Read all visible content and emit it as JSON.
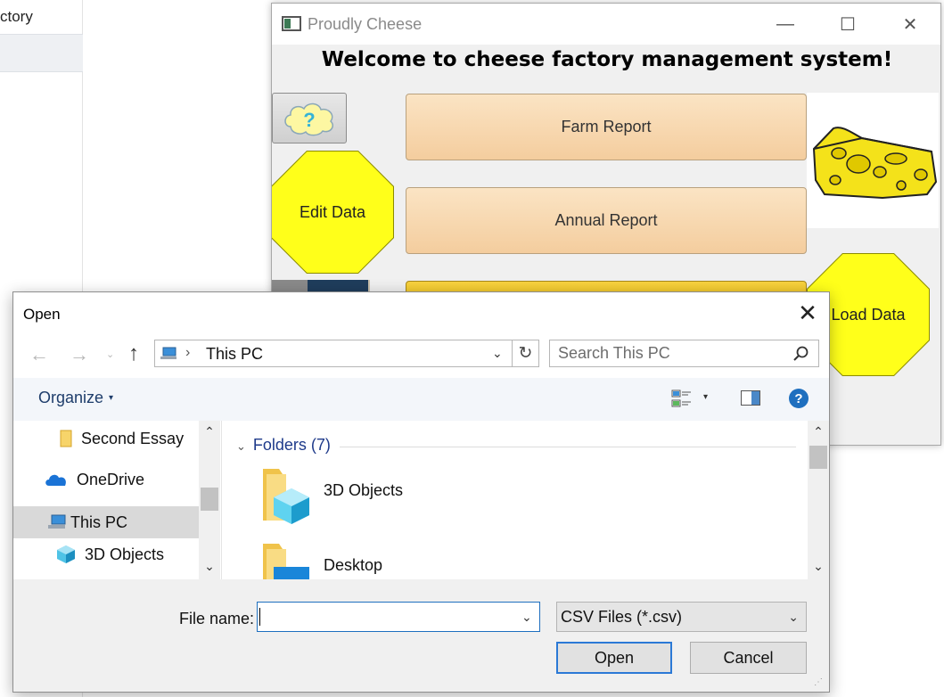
{
  "background_app": {
    "tree_item_label": "ctory"
  },
  "cheese_window": {
    "title": "Proudly Cheese",
    "controls": {
      "minimize": "—",
      "maximize": "☐",
      "close": "✕"
    },
    "heading": "Welcome to cheese factory management system!",
    "buttons": {
      "farm_report": "Farm Report",
      "annual_report": "Annual Report",
      "edit_data": "Edit Data",
      "load_data": "Load Data"
    },
    "help_button_glyph": "?",
    "icons": {
      "help": "question-cloud-icon",
      "cheese": "cheese-image"
    },
    "colors": {
      "octagon": "#ffff1a",
      "report_button": "#f7d7ab",
      "third_button": "#f0c419"
    }
  },
  "open_dialog": {
    "title": "Open",
    "close_glyph": "✕",
    "nav": {
      "back": "←",
      "forward": "→",
      "recent": "⌄",
      "up": "↑"
    },
    "address": {
      "separator": "›",
      "location": "This PC",
      "dropdown": "⌄"
    },
    "refresh_glyph": "↻",
    "search": {
      "placeholder": "Search This PC"
    },
    "toolbar": {
      "organize_label": "Organize",
      "organize_caret": "▾",
      "view_caret": "▾",
      "help_glyph": "?"
    },
    "nav_pane": {
      "items": [
        {
          "label": "Second Essay",
          "icon": "folder-icon"
        },
        {
          "label": "OneDrive",
          "icon": "cloud-icon"
        },
        {
          "label": "This PC",
          "icon": "computer-icon",
          "selected": true
        },
        {
          "label": "3D Objects",
          "icon": "cube-icon"
        }
      ],
      "scroll_up": "⌃",
      "scroll_down": "⌄"
    },
    "file_list": {
      "group_header": "Folders (7)",
      "group_chevron": "⌄",
      "items": [
        {
          "name": "3D Objects",
          "icon": "3d-objects-folder-icon"
        },
        {
          "name": "Desktop",
          "icon": "desktop-folder-icon"
        }
      ],
      "scroll_up": "⌃",
      "scroll_down": "⌄"
    },
    "file_name": {
      "label": "File name:",
      "value": "",
      "dropdown": "⌄"
    },
    "file_type": {
      "selected": "CSV Files (*.csv)",
      "dropdown": "⌄"
    },
    "buttons": {
      "open": "Open",
      "cancel": "Cancel"
    },
    "resize_grip": "⋰"
  }
}
